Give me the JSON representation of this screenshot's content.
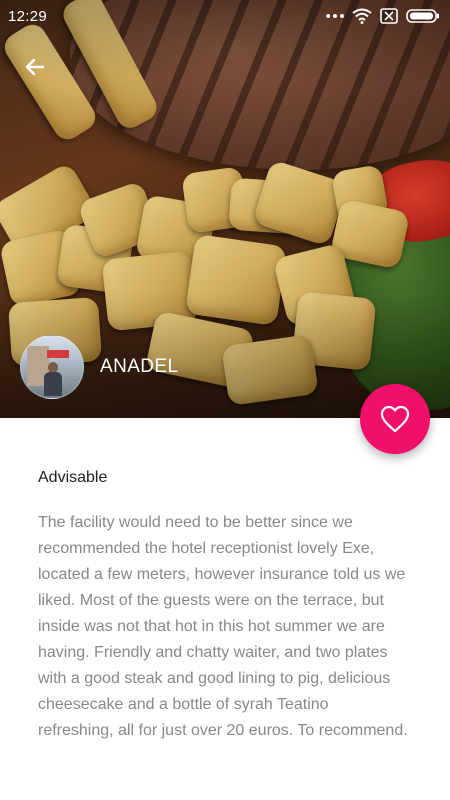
{
  "status_bar": {
    "time": "12:29",
    "icons": [
      "more-dots-icon",
      "wifi-icon",
      "sim-icon",
      "battery-icon"
    ]
  },
  "colors": {
    "accent": "#f0106b",
    "title_text": "#222222",
    "body_text": "#888888"
  },
  "author": {
    "name": "ANADEL"
  },
  "review": {
    "title": "Advisable",
    "body": "The facility would need to be better since we recommended the hotel receptionist lovely Exe, located a few meters, however insurance told us we liked. Most of the guests were on the terrace, but inside was not that hot in this hot summer we are having. Friendly and chatty waiter, and two plates with a good steak and good lining to pig, delicious cheesecake and a bottle of syrah Teatino refreshing, all for just over 20 euros. To recommend."
  }
}
